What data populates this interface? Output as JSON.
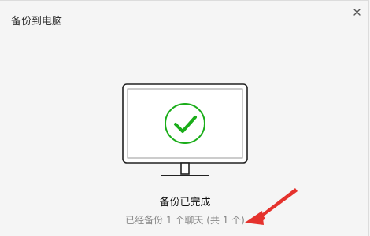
{
  "window": {
    "title": "备份到电脑"
  },
  "backup": {
    "status": "备份已完成",
    "summary": "已经备份 1 个聊天 (共 1 个)"
  },
  "colors": {
    "success_green": "#1aad19",
    "annotation_red": "#e5322d",
    "dialog_bg": "#f5f5f5"
  },
  "icons": {
    "close": "close-icon",
    "monitor": "monitor-icon",
    "check": "check-circle-icon"
  }
}
